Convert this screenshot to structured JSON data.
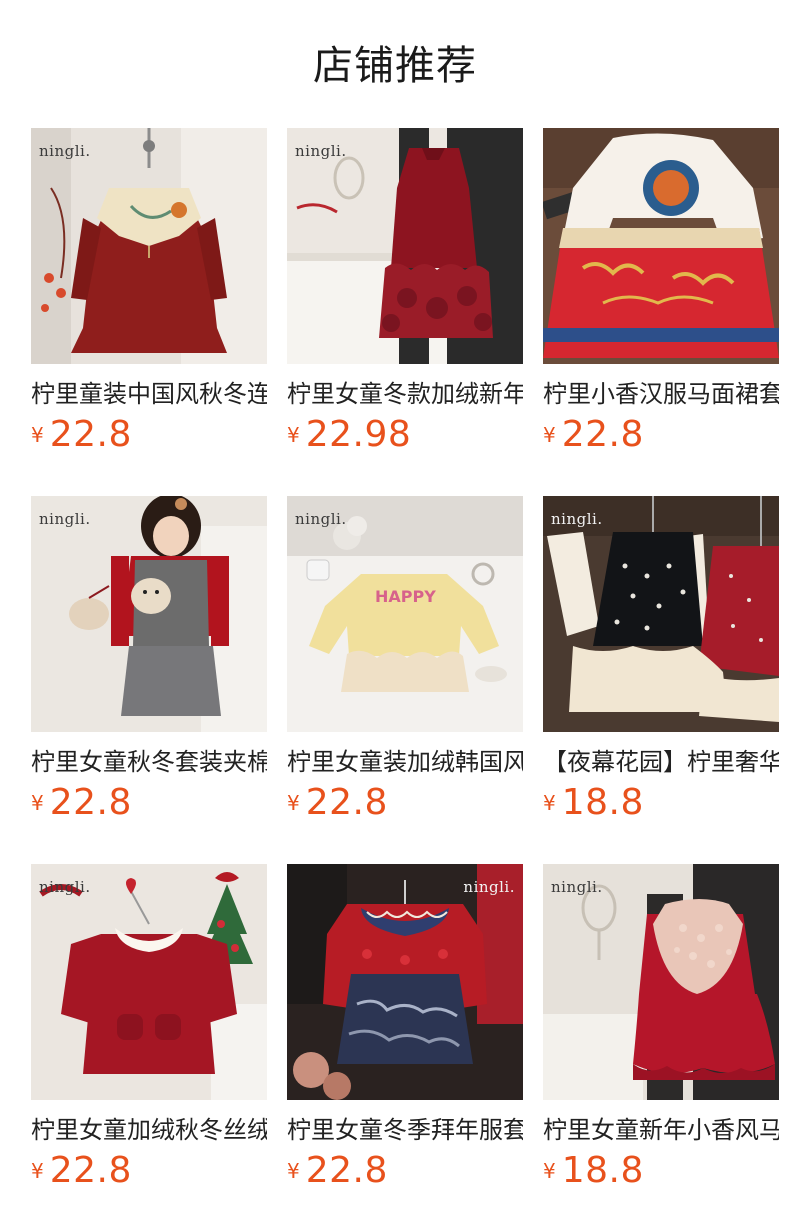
{
  "header": {
    "title": "店铺推荐"
  },
  "products": [
    {
      "brand": "ningli.",
      "name": "柠里童装中国风秋冬连衣裙",
      "currency": "¥",
      "price": "22.8"
    },
    {
      "brand": "ningli.",
      "name": "柠里女童冬款加绒新年马甲裙",
      "currency": "¥",
      "price": "22.98"
    },
    {
      "brand": "",
      "name": "柠里小香汉服马面裙套装",
      "currency": "¥",
      "price": "22.8"
    },
    {
      "brand": "ningli.",
      "name": "柠里女童秋冬套装夹棉背心裙",
      "currency": "¥",
      "price": "22.8"
    },
    {
      "brand": "ningli.",
      "name": "柠里女童装加绒韩国风卫衣裙",
      "currency": "¥",
      "price": "22.8"
    },
    {
      "brand": "ningli.",
      "name": "【夜幕花园】柠里奢华连衣裙",
      "currency": "¥",
      "price": "18.8"
    },
    {
      "brand": "ningli.",
      "name": "柠里女童加绒秋冬丝绒连衣裙",
      "currency": "¥",
      "price": "22.8"
    },
    {
      "brand": "ningli.",
      "name": "柠里女童冬季拜年服套装",
      "currency": "¥",
      "price": "22.8"
    },
    {
      "brand": "ningli.",
      "name": "柠里女童新年小香风马甲裙",
      "currency": "¥",
      "price": "18.8"
    }
  ]
}
